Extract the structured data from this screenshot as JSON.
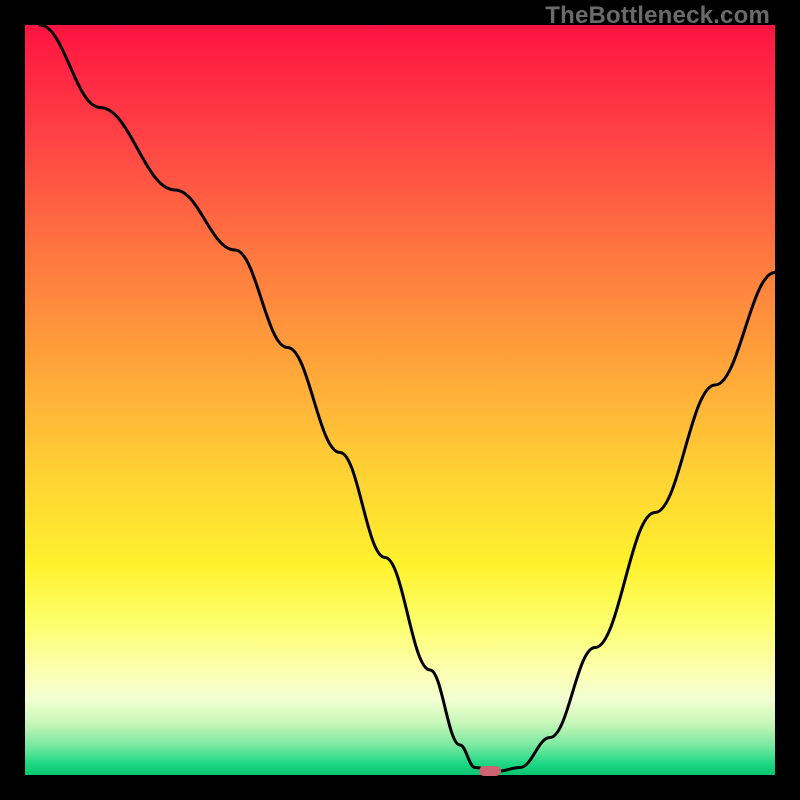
{
  "watermark": "TheBottleneck.com",
  "chart_data": {
    "type": "line",
    "title": "",
    "xlabel": "",
    "ylabel": "",
    "xlim": [
      0,
      100
    ],
    "ylim": [
      0,
      100
    ],
    "x": [
      2,
      10,
      20,
      28,
      35,
      42,
      48,
      54,
      58,
      60,
      63,
      66,
      70,
      76,
      84,
      92,
      100
    ],
    "values": [
      100,
      89,
      78,
      70,
      57,
      43,
      29,
      14,
      4,
      1,
      0.5,
      1,
      5,
      17,
      35,
      52,
      67
    ],
    "marker": {
      "x": 62,
      "y": 0.5
    },
    "gradient_stops": [
      {
        "pos": 0.0,
        "color": "#ff1342"
      },
      {
        "pos": 0.15,
        "color": "#ff4245"
      },
      {
        "pos": 0.3,
        "color": "#ff7540"
      },
      {
        "pos": 0.45,
        "color": "#ffa33a"
      },
      {
        "pos": 0.6,
        "color": "#ffd234"
      },
      {
        "pos": 0.72,
        "color": "#fff22e"
      },
      {
        "pos": 0.8,
        "color": "#fdff6e"
      },
      {
        "pos": 0.86,
        "color": "#fcffb0"
      },
      {
        "pos": 0.9,
        "color": "#f2ffd2"
      },
      {
        "pos": 0.93,
        "color": "#c9f7b9"
      },
      {
        "pos": 0.96,
        "color": "#7be9a1"
      },
      {
        "pos": 0.985,
        "color": "#1ed784"
      },
      {
        "pos": 1.0,
        "color": "#09c56f"
      }
    ]
  }
}
